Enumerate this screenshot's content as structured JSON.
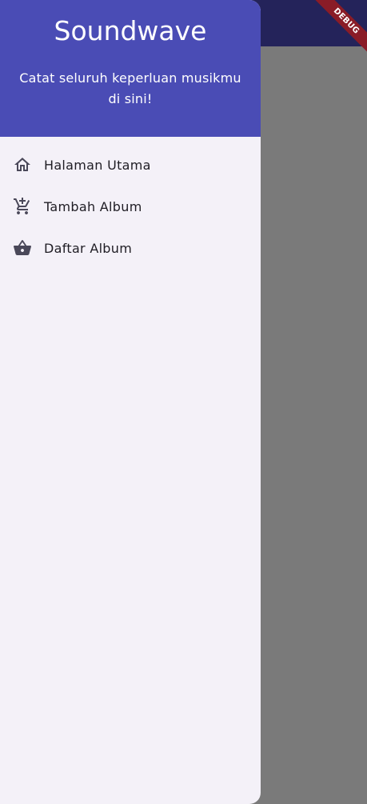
{
  "drawer": {
    "title": "Soundwave",
    "subtitle": "Catat seluruh keperluan musikmu di sini!",
    "items": [
      {
        "label": "Halaman Utama",
        "icon": "home-icon"
      },
      {
        "label": "Tambah Album",
        "icon": "add-shopping-cart-icon"
      },
      {
        "label": "Daftar Album",
        "icon": "shopping-basket-icon"
      }
    ]
  },
  "debug_banner": "DEBUG",
  "colors": {
    "header_bg": "#4a4cb5",
    "drawer_bg": "#f4f1f8",
    "scrim": "#7a7a7a",
    "appbar_dim": "#24235a",
    "debug_ribbon": "#8a1c27"
  }
}
